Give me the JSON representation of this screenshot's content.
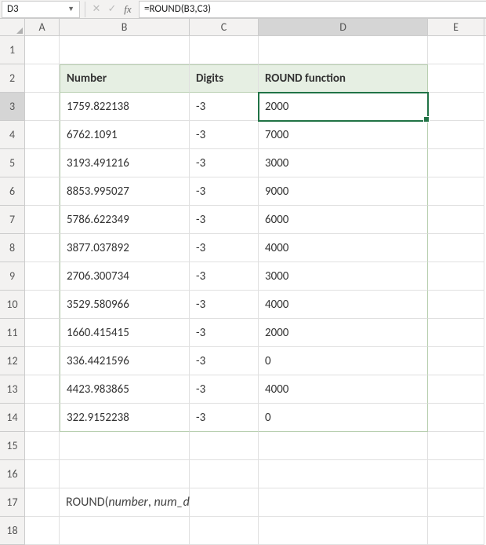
{
  "formula_bar": {
    "cell_ref": "D3",
    "cancel_label": "✕",
    "enter_label": "✓",
    "fx_label": "fx",
    "formula": "=ROUND(B3,C3)"
  },
  "columns": {
    "A": "A",
    "B": "B",
    "C": "C",
    "D": "D",
    "E": "E"
  },
  "table": {
    "headers": {
      "number": "Number",
      "digits": "Digits",
      "round": "ROUND function"
    },
    "rows": [
      {
        "number": "1759.822138",
        "digits": "-3",
        "round": "2000"
      },
      {
        "number": "6762.1091",
        "digits": "-3",
        "round": "7000"
      },
      {
        "number": "3193.491216",
        "digits": "-3",
        "round": "3000"
      },
      {
        "number": "8853.995027",
        "digits": "-3",
        "round": "9000"
      },
      {
        "number": "5786.622349",
        "digits": "-3",
        "round": "6000"
      },
      {
        "number": "3877.037892",
        "digits": "-3",
        "round": "4000"
      },
      {
        "number": "2706.300734",
        "digits": "-3",
        "round": "3000"
      },
      {
        "number": "3529.580966",
        "digits": "-3",
        "round": "4000"
      },
      {
        "number": "1660.415415",
        "digits": "-3",
        "round": "2000"
      },
      {
        "number": "336.4421596",
        "digits": "-3",
        "round": "0"
      },
      {
        "number": "4423.983865",
        "digits": "-3",
        "round": "4000"
      },
      {
        "number": "322.9152238",
        "digits": "-3",
        "round": "0"
      }
    ]
  },
  "syntax": {
    "fn": "ROUND(",
    "arg1": "number",
    "sep": ", ",
    "arg2": "num_digits",
    "close": " )"
  },
  "selected_cell": "D3"
}
